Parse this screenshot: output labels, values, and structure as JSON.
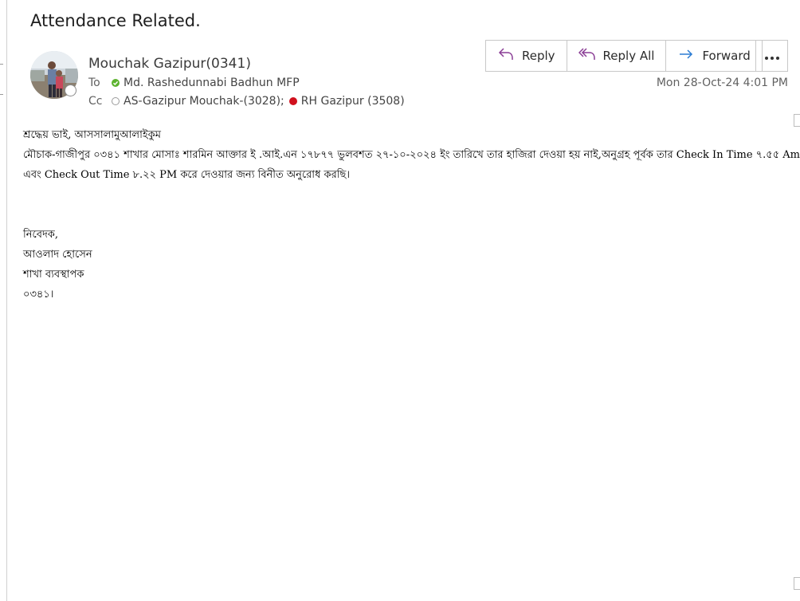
{
  "email": {
    "subject": "Attendance Related.",
    "sender": "Mouchak Gazipur(0341)",
    "to_label": "To",
    "to_name": "Md. Rashedunnabi Badhun MFP",
    "cc_label": "Cc",
    "cc_1": "AS-Gazipur Mouchak-(3028);",
    "cc_2": "RH Gazipur (3508)",
    "datetime": "Mon 28-Oct-24 4:01 PM"
  },
  "actions": {
    "reply": "Reply",
    "reply_all": "Reply All",
    "forward": "Forward"
  },
  "body": {
    "greeting": "শ্রদ্ধেয় ভাই, আসসালামুআলাইকুম",
    "line1": "মৌচাক-গাজীপুর ০৩৪১ শাখার মোসাঃ শারমিন আক্তার ই .আই.এন ১৭৮৭৭ ভুলবশত ২৭-১০-২০২৪ ইং তারিখে তার হাজিরা দেওয়া হয় নাই,অনুগ্রহ পূর্বক তার Check In Time ৭.৫৫ Am",
    "line2": "এবং Check Out Time ৮.২২ PM করে দেওয়ার জন্য বিনীত অনুরোধ করছি।",
    "sig1": "নিবেদক,",
    "sig2": "আওলাদ হোসেন",
    "sig3": "শাখা ব্যবস্থাপক",
    "sig4": "০৩৪১।"
  },
  "colors": {
    "accent": "#8a3d95",
    "forward_arrow": "#2a7bd3",
    "presence_green": "#5db32f",
    "presence_red": "#d0101d"
  }
}
